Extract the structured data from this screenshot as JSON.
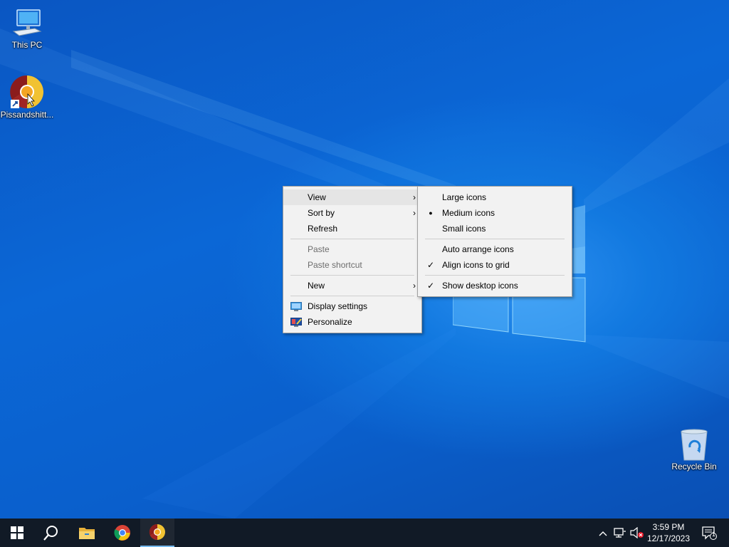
{
  "desktop": {
    "icons": [
      {
        "label": "This PC",
        "icon": "computer-icon"
      },
      {
        "label": "Pissandshitt...",
        "icon": "chrome-canary-shortcut-icon"
      },
      {
        "label": "Recycle Bin",
        "icon": "recycle-bin-icon"
      }
    ]
  },
  "context_menu": {
    "items": [
      {
        "label": "View",
        "submenu": true,
        "highlighted": true
      },
      {
        "label": "Sort by",
        "submenu": true
      },
      {
        "label": "Refresh"
      },
      {
        "label": "Paste",
        "disabled": true
      },
      {
        "label": "Paste shortcut",
        "disabled": true
      },
      {
        "label": "New",
        "submenu": true
      },
      {
        "label": "Display settings",
        "icon": "display-settings-icon"
      },
      {
        "label": "Personalize",
        "icon": "personalize-icon"
      }
    ],
    "arrow_glyph": "›"
  },
  "view_submenu": {
    "items": [
      {
        "label": "Large icons"
      },
      {
        "label": "Medium icons",
        "mark": "bullet"
      },
      {
        "label": "Small icons"
      },
      {
        "label": "Auto arrange icons"
      },
      {
        "label": "Align icons to grid",
        "mark": "check"
      },
      {
        "label": "Show desktop icons",
        "mark": "check"
      }
    ],
    "bullet_glyph": "●",
    "check_glyph": "✓"
  },
  "taskbar": {
    "buttons": [
      "start-button",
      "search-button",
      "file-explorer-button",
      "chrome-button",
      "chrome-canary-button"
    ],
    "clock": {
      "time": "3:59 PM",
      "date": "12/17/2023"
    },
    "notification_count": "1",
    "tray_chevron": "^"
  },
  "colors": {
    "taskbar": "#111a26",
    "menu_bg": "#f2f2f2",
    "menu_hover": "#e5e5e5",
    "accent": "#0a5fcc"
  }
}
